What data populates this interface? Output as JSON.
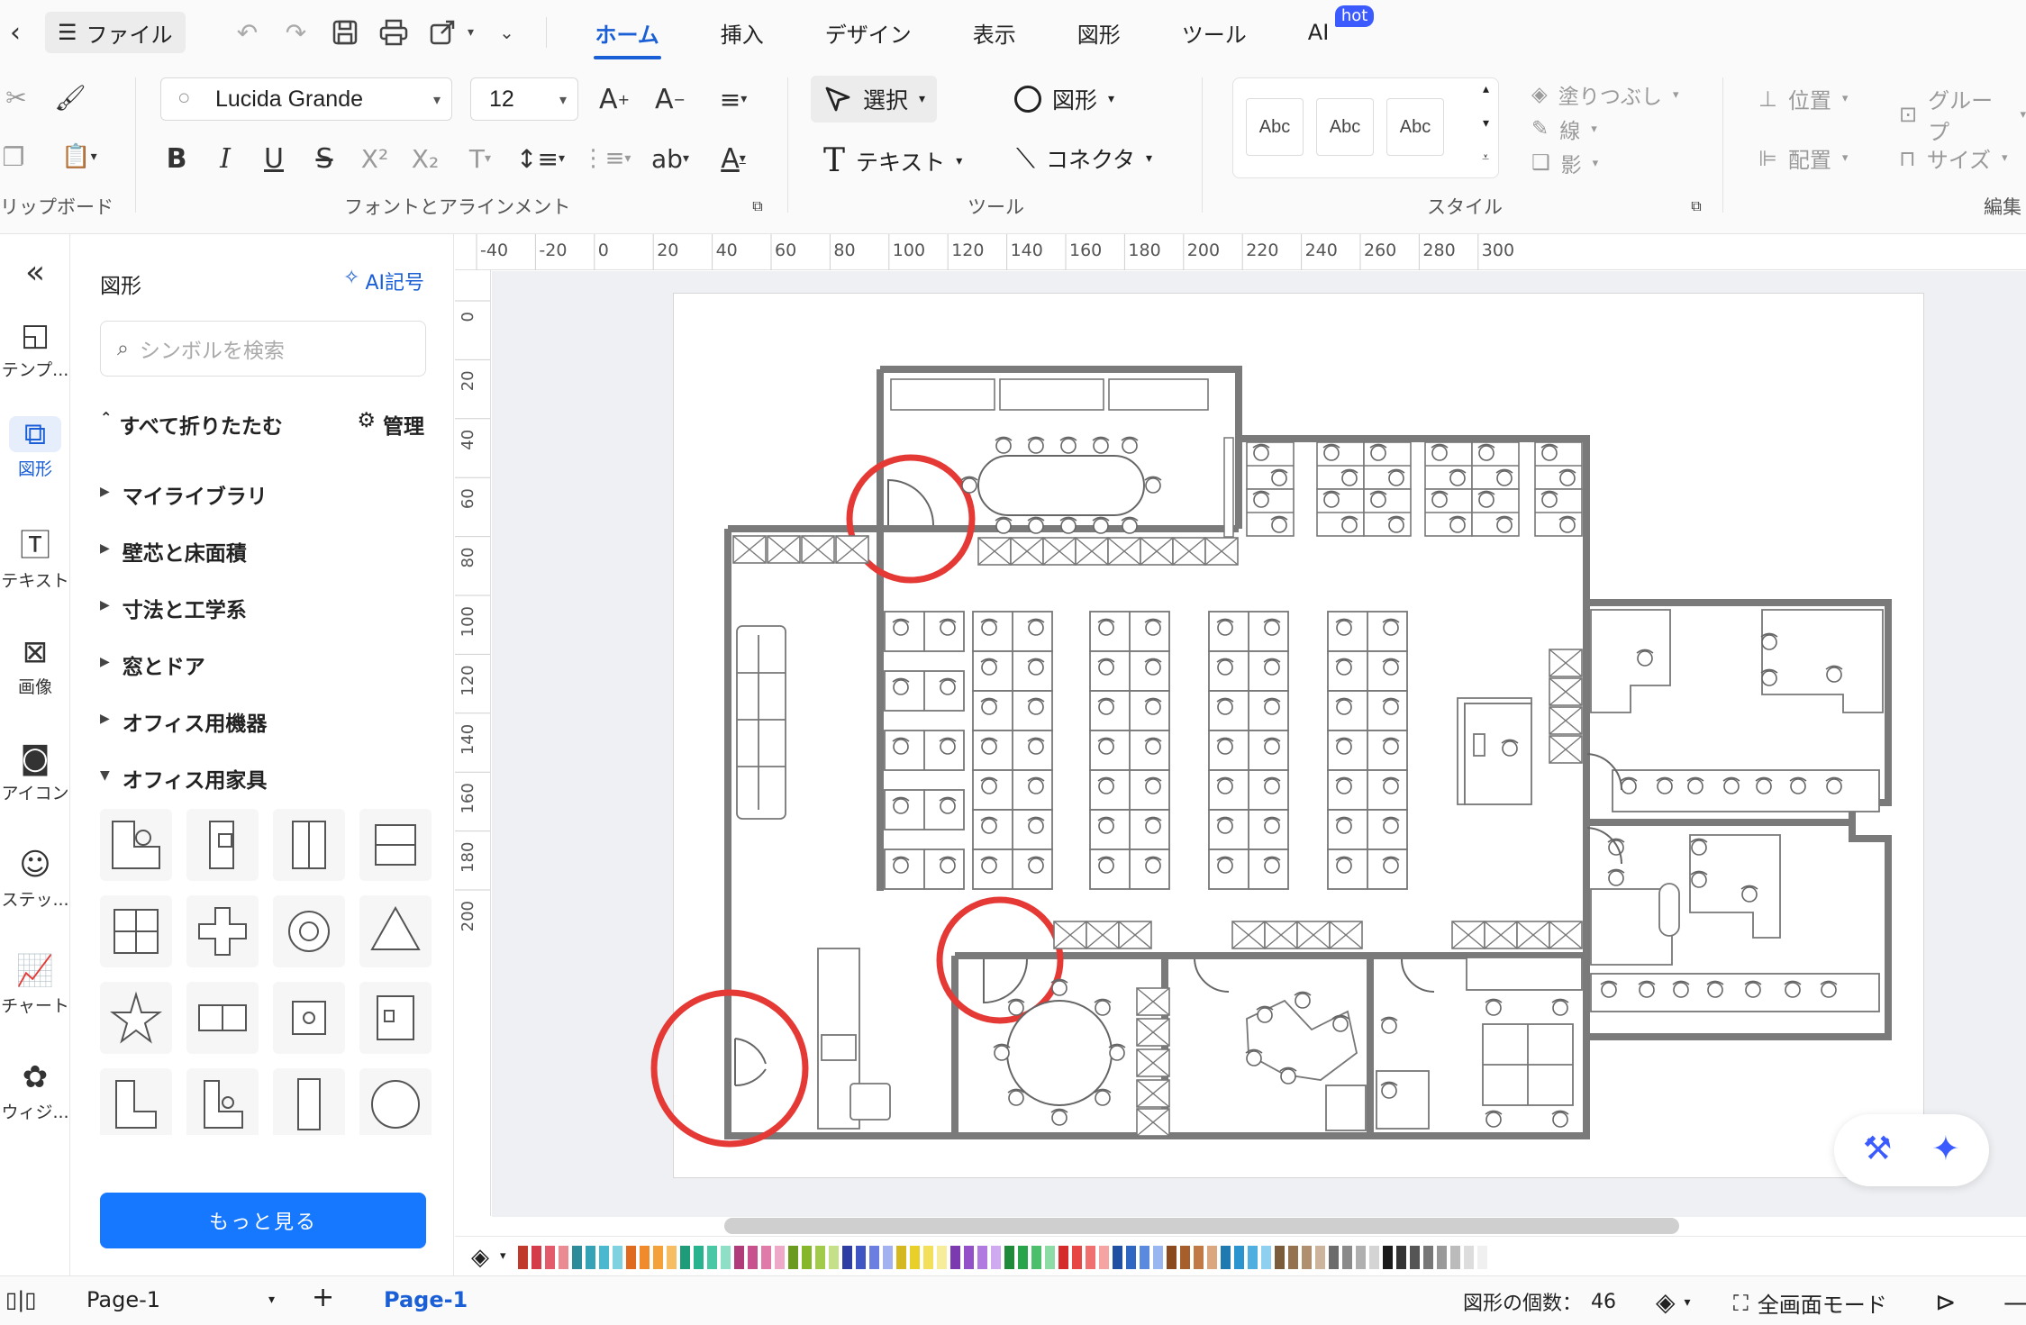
{
  "menubar": {
    "file_label": "ファイル",
    "tabs": [
      {
        "label": "ホーム",
        "active": true
      },
      {
        "label": "挿入",
        "active": false
      },
      {
        "label": "デザイン",
        "active": false
      },
      {
        "label": "表示",
        "active": false
      },
      {
        "label": "図形",
        "active": false
      },
      {
        "label": "ツール",
        "active": false
      },
      {
        "label": "AI",
        "active": false,
        "badge": "hot"
      }
    ]
  },
  "ribbon": {
    "clipboard_label": "リップボード",
    "font_name": "Lucida Grande",
    "font_size": "12",
    "font_group_label": "フォントとアラインメント",
    "select_label": "選択",
    "shape_label": "図形",
    "text_label": "テキスト",
    "connector_label": "コネクタ",
    "tools_group_label": "ツール",
    "style_samples": [
      "Abc",
      "Abc",
      "Abc"
    ],
    "fill_label": "塗りつぶし",
    "line_label": "線",
    "shadow_label": "影",
    "style_group_label": "スタイル",
    "position_label": "位置",
    "group_label": "グループ",
    "align_label": "配置",
    "size_label": "サイズ",
    "edit_group_label": "編集",
    "bold": "B",
    "italic": "I",
    "underline": "U",
    "strike": "S"
  },
  "rail": {
    "items": [
      {
        "icon": "template-icon",
        "label": "テンプ..."
      },
      {
        "icon": "shapes-icon",
        "label": "図形",
        "active": true
      },
      {
        "icon": "text-icon",
        "label": "テキスト"
      },
      {
        "icon": "image-icon",
        "label": "画像"
      },
      {
        "icon": "icon-icon",
        "label": "アイコン"
      },
      {
        "icon": "sticker-icon",
        "label": "ステッ..."
      },
      {
        "icon": "chart-icon",
        "label": "チャート"
      },
      {
        "icon": "widget-icon",
        "label": "ウィジ..."
      }
    ]
  },
  "panel": {
    "title": "図形",
    "ai_label": "AI記号",
    "search_placeholder": "シンボルを検索",
    "collapse_all": "すべて折りたたむ",
    "manage": "管理",
    "categories": [
      "マイライブラリ",
      "壁芯と床面積",
      "寸法と工学系",
      "窓とドア",
      "オフィス用機器",
      "オフィス用家具"
    ],
    "more_button": "もっと見る"
  },
  "rulers": {
    "h_ticks": [
      "-40",
      "-20",
      "0",
      "20",
      "40",
      "60",
      "80",
      "100",
      "120",
      "140",
      "160",
      "180",
      "200",
      "220",
      "240",
      "260",
      "280",
      "300"
    ],
    "v_ticks": [
      "0",
      "20",
      "40",
      "60",
      "80",
      "100",
      "120",
      "140",
      "160",
      "180",
      "200"
    ]
  },
  "palette": {
    "colors": [
      "#c0392b",
      "#d63b4a",
      "#e35a6b",
      "#ea8a93",
      "#2c8c99",
      "#33a3b5",
      "#4ab9cf",
      "#7fd3e0",
      "#e06b1e",
      "#f08a2a",
      "#f4a13a",
      "#f7bd63",
      "#1e9c7a",
      "#26b38d",
      "#4ac7a4",
      "#8edfc6",
      "#b03a7a",
      "#c9508f",
      "#e07aa9",
      "#efa9c8",
      "#6b9b1e",
      "#86b629",
      "#a3cb4b",
      "#c6e08a",
      "#2c3ea3",
      "#3f55c4",
      "#6b7fe0",
      "#a3b1f0",
      "#d4b81e",
      "#e8cf2a",
      "#f2df5a",
      "#f7ec9a",
      "#7b3ab0",
      "#9350c9",
      "#b07ae0",
      "#cfaaf0",
      "#1e8a3a",
      "#27a349",
      "#4cbf6c",
      "#8edca5",
      "#d62b2b",
      "#e84545",
      "#f07070",
      "#f5a3a3",
      "#1e4fa3",
      "#2e66c4",
      "#5a8ae0",
      "#9ab6f0",
      "#8a4a1e",
      "#a65f2a",
      "#c27a45",
      "#dba77f",
      "#1e7ab0",
      "#2a94cf",
      "#4fb0e0",
      "#8fd0f0",
      "#7a5c3a",
      "#947250",
      "#b08f6e",
      "#ccb59c",
      "#6b6b6b",
      "#8a8a8a",
      "#b0b0b0",
      "#d4d4d4",
      "#1a1a1a",
      "#333333",
      "#555555",
      "#777777",
      "#999999",
      "#bbbbbb",
      "#dddddd",
      "#f0f0f0"
    ]
  },
  "status": {
    "page_selector": "Page-1",
    "page_tab": "Page-1",
    "shape_count_label": "図形の個数：",
    "shape_count": "46",
    "fullscreen_label": "全画面モード"
  }
}
